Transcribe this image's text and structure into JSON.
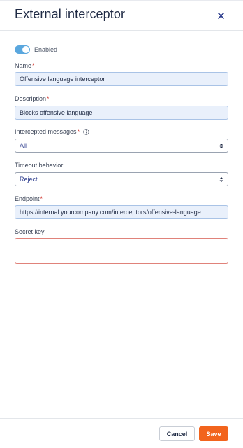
{
  "header": {
    "title": "External interceptor",
    "close_icon": "close-icon"
  },
  "enabled_toggle": {
    "label": "Enabled",
    "on": true,
    "color": "#5aa7de"
  },
  "form": {
    "name": {
      "label": "Name",
      "required_mark": "*",
      "value": "Offensive language interceptor"
    },
    "description": {
      "label": "Description",
      "required_mark": "*",
      "value": "Blocks offensive language"
    },
    "intercepted_messages": {
      "label": "Intercepted messages",
      "required_mark": "*",
      "info_icon": "info-icon",
      "selected": "All"
    },
    "timeout_behavior": {
      "label": "Timeout behavior",
      "selected": "Reject"
    },
    "endpoint": {
      "label": "Endpoint",
      "required_mark": "*",
      "value": "https://internal.yourcompany.com/interceptors/offensive-language"
    },
    "secret_key": {
      "label": "Secret key",
      "value": ""
    }
  },
  "footer": {
    "cancel_label": "Cancel",
    "save_label": "Save",
    "accent_color": "#f2641d"
  }
}
